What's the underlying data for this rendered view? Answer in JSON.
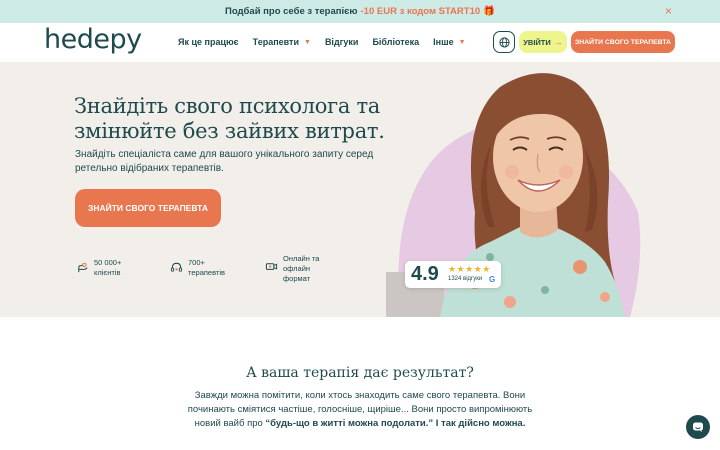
{
  "promo": {
    "text": "Подбай про себе з терапією",
    "code_text": "-10 EUR з кодом START10",
    "gift": "🎁",
    "close": "×"
  },
  "header": {
    "logo": "hedepy",
    "nav": [
      {
        "label": "Як це працює",
        "has_chevron": false
      },
      {
        "label": "Терапевти",
        "has_chevron": true
      },
      {
        "label": "Відгуки",
        "has_chevron": false
      },
      {
        "label": "Бібліотека",
        "has_chevron": false
      },
      {
        "label": "Інше",
        "has_chevron": true
      }
    ],
    "login_label": "УВІЙТИ",
    "login_arrow": "→",
    "cta_label": "ЗНАЙТИ СВОГО ТЕРАПЕВТА"
  },
  "hero": {
    "title": "Знайдіть свого психолога та змінюйте без зайвих витрат.",
    "subtitle": "Знайдіть спеціаліста саме для вашого унікального запиту серед ретельно відібраних терапевтів.",
    "cta_label": "ЗНАЙТИ СВОГО ТЕРАПЕВТА",
    "stats": [
      {
        "icon": "hand-heart-icon",
        "text": "50 000+ клієнтів"
      },
      {
        "icon": "headset-icon",
        "text": "700+ терапевтів"
      },
      {
        "icon": "video-chat-icon",
        "text": "Онлайн та офлайн формат"
      }
    ],
    "rating": {
      "score": "4.9",
      "stars": "★★★★★",
      "star_value": 5,
      "reviews": "1324 відгуки",
      "google": "G"
    }
  },
  "section2": {
    "title": "А ваша терапія дає результат?",
    "text_plain": "Завжди можна помітити, коли хтось знаходить саме свого терапевта. Вони починають сміятися частіше, голосніше, щиріше... Вони просто випромінюють новий вайб про",
    "text_bold": "“будь-що в житті можна подолати.” І так дійсно можна."
  },
  "colors": {
    "brand_dark": "#1f4a4d",
    "accent_orange": "#e8764f",
    "promo_bg": "#cdeae6",
    "login_bg": "#eff58d",
    "hero_bg": "#f2eee9",
    "blob_pink": "#e6c9e2"
  }
}
